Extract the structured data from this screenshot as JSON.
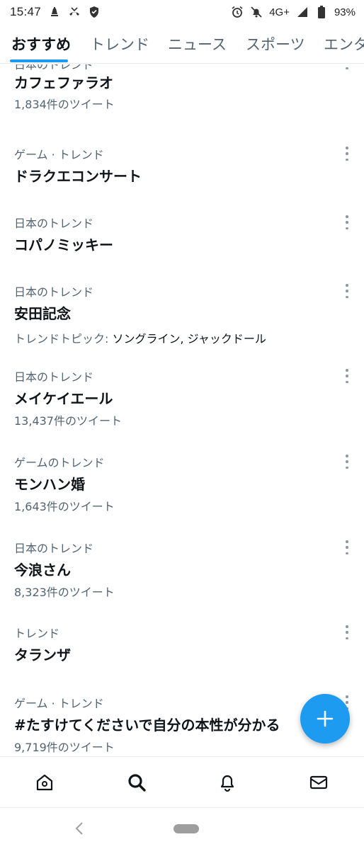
{
  "status_bar": {
    "time": "15:47",
    "network": "4G+",
    "battery": "93%",
    "icons_left": [
      "notification-icon",
      "missed-call-icon",
      "shield-icon"
    ],
    "icons_right": [
      "alarm-icon",
      "mute-icon",
      "signal-icon",
      "battery-icon"
    ]
  },
  "tabs": [
    {
      "label": "おすすめ",
      "active": true
    },
    {
      "label": "トレンド",
      "active": false
    },
    {
      "label": "ニュース",
      "active": false
    },
    {
      "label": "スポーツ",
      "active": false
    },
    {
      "label": "エンタ",
      "active": false
    }
  ],
  "trends": [
    {
      "category": "日本のトレンド",
      "title": "カフェファラオ",
      "meta": "1,834件のツイート"
    },
    {
      "category": "ゲーム · トレンド",
      "title": "ドラクエコンサート",
      "meta": ""
    },
    {
      "category": "日本のトレンド",
      "title": "コパノミッキー",
      "meta": ""
    },
    {
      "category": "日本のトレンド",
      "title": "安田記念",
      "meta_label": "トレンドトピック: ",
      "meta_value": "ソングライン, ジャックドール"
    },
    {
      "category": "日本のトレンド",
      "title": "メイケイエール",
      "meta": "13,437件のツイート"
    },
    {
      "category": "ゲームのトレンド",
      "title": "モンハン婚",
      "meta": "1,643件のツイート"
    },
    {
      "category": "日本のトレンド",
      "title": "今浪さん",
      "meta": "8,323件のツイート"
    },
    {
      "category": "トレンド",
      "title": "タランザ",
      "meta": ""
    },
    {
      "category": "ゲーム · トレンド",
      "title": "#たすけてくださいで自分の本性が分かる",
      "meta": "9,719件のツイート"
    }
  ],
  "fab": {
    "icon": "plus-icon",
    "color": "#1d9bf0"
  },
  "bottom_nav": [
    {
      "name": "home",
      "icon": "home-icon"
    },
    {
      "name": "search",
      "icon": "search-icon"
    },
    {
      "name": "notifications",
      "icon": "bell-icon"
    },
    {
      "name": "messages",
      "icon": "mail-icon"
    }
  ],
  "colors": {
    "accent": "#1d9bf0",
    "text": "#0f1419",
    "secondary": "#536471"
  }
}
